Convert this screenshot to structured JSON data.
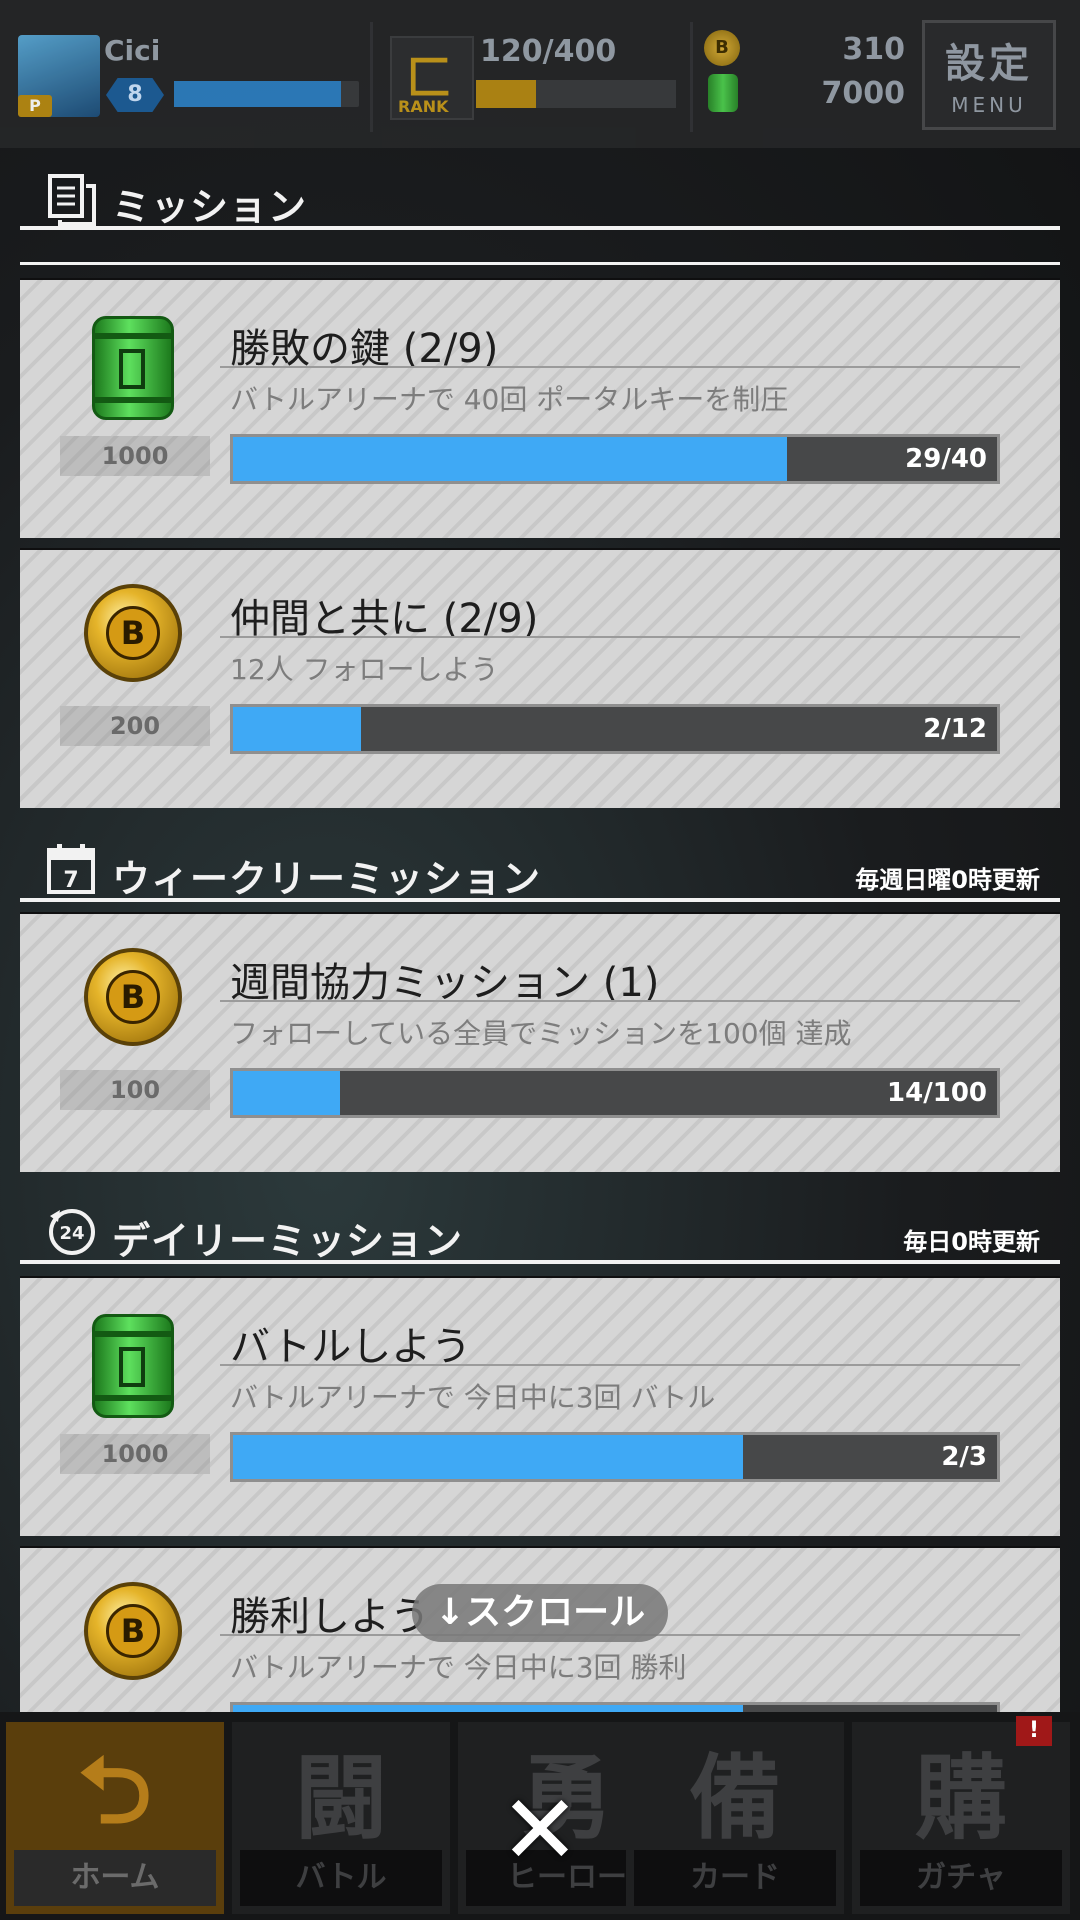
{
  "status_bar": {
    "player_name": "Cici",
    "avatar_tag": "P",
    "level": "8",
    "exp_fraction": 0.9,
    "rank_icon_text": "RANK",
    "rank_progress": "120/400",
    "rank_fraction": 0.3,
    "coins": "310",
    "gems": "7000",
    "coin_icon_char": "B",
    "menu_kanji": "設定",
    "menu_label": "MENU"
  },
  "sections": {
    "missions": {
      "title": "ミッション"
    },
    "weekly": {
      "title": "ウィークリーミッション",
      "refresh": "毎週日曜0時更新",
      "icon_text": "7"
    },
    "daily": {
      "title": "デイリーミッション",
      "refresh": "毎日0時更新",
      "icon_text": "24"
    }
  },
  "cards": [
    {
      "title": "勝敗の鍵 (2/9)",
      "desc": "バトルアリーナで 40回 ポータルキーを制圧",
      "reward": "1000",
      "reward_type": "canister",
      "progress_text": "29/40",
      "progress_fraction": 0.725
    },
    {
      "title": "仲間と共に (2/9)",
      "desc": "12人 フォローしよう",
      "reward": "200",
      "reward_type": "coin",
      "progress_text": "2/12",
      "progress_fraction": 0.167
    },
    {
      "title": "週間協力ミッション (1)",
      "desc": "フォローしている全員でミッションを100個 達成",
      "reward": "100",
      "reward_type": "coin",
      "progress_text": "14/100",
      "progress_fraction": 0.14
    },
    {
      "title": "バトルしよう",
      "desc": "バトルアリーナで 今日中に3回 バトル",
      "reward": "1000",
      "reward_type": "canister",
      "progress_text": "2/3",
      "progress_fraction": 0.667
    },
    {
      "title": "勝利しよう",
      "desc": "バトルアリーナで 今日中に3回 勝利",
      "reward": "",
      "reward_type": "coin",
      "progress_text": "",
      "progress_fraction": 0.667
    }
  ],
  "scroll_hint": "↓スクロール",
  "nav": {
    "home": {
      "glyph": "⮌",
      "label": "ホーム"
    },
    "battle": {
      "glyph": "闘",
      "label": "バトル"
    },
    "hero": {
      "glyph": "勇",
      "label": "ヒーロー"
    },
    "card": {
      "glyph": "備",
      "label": "カード"
    },
    "gacha": {
      "glyph": "購",
      "label": "ガチャ",
      "badge": "!"
    }
  },
  "close_label": "✕",
  "colors": {
    "progress": "#3fa9f5",
    "coin": "#e5b42a",
    "canister": "#4fd14f",
    "home_tab": "#b57d1a"
  }
}
